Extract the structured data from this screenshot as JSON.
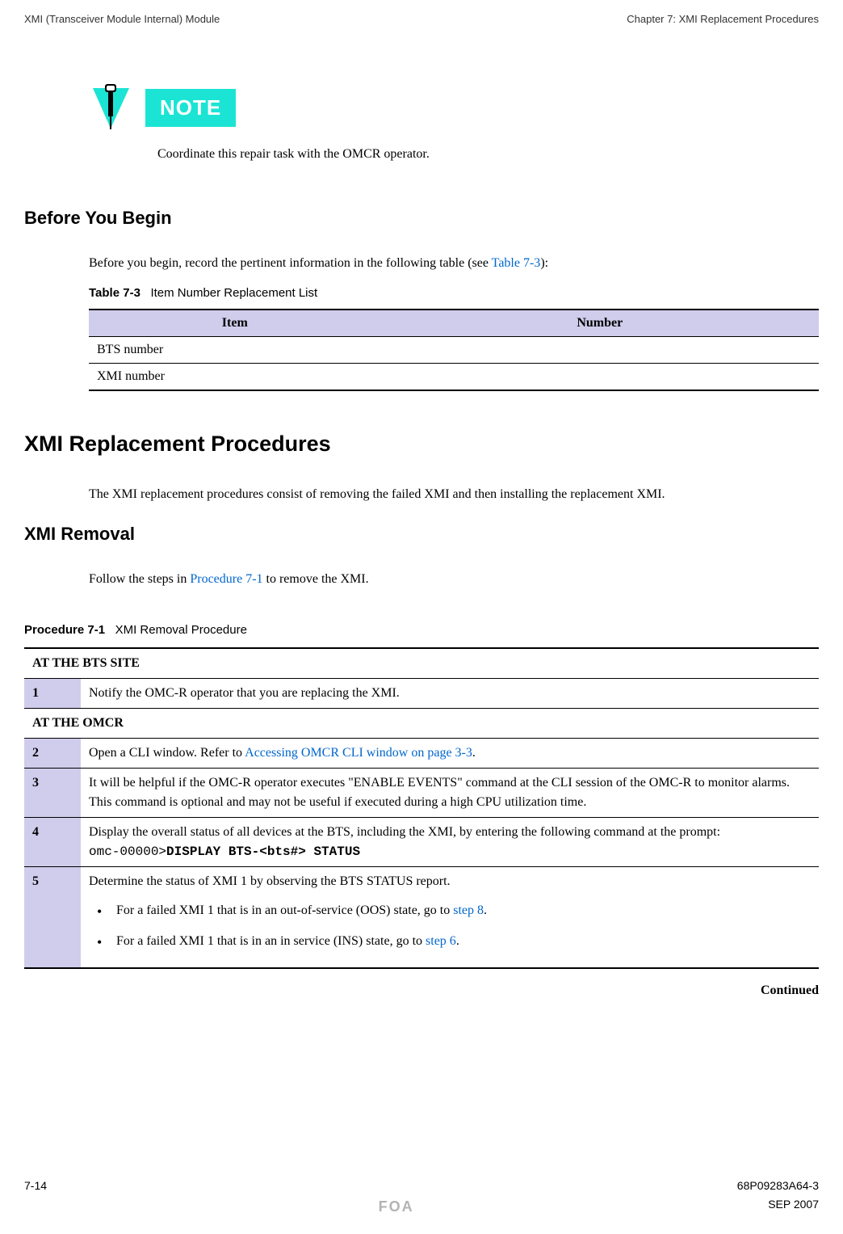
{
  "header": {
    "left": "XMI (Transceiver Module Internal) Module",
    "right": "Chapter 7: XMI Replacement Procedures"
  },
  "note": {
    "badge": "NOTE",
    "text": "Coordinate this repair task with the OMCR operator."
  },
  "sections": {
    "before_begin": {
      "title": "Before You Begin",
      "intro_pre": "Before you begin, record the pertinent information in the following table (see ",
      "intro_link": "Table 7-3",
      "intro_post": "):"
    },
    "table73": {
      "caption_bold": "Table 7-3",
      "caption_rest": "Item Number Replacement List",
      "headers": {
        "item": "Item",
        "number": "Number"
      },
      "rows": [
        {
          "item": "BTS number",
          "number": ""
        },
        {
          "item": "XMI number",
          "number": ""
        }
      ]
    },
    "xmi_proc": {
      "title": "XMI Replacement Procedures",
      "intro": "The XMI replacement procedures consist of removing the failed XMI and then installing the replacement XMI."
    },
    "xmi_removal": {
      "title": "XMI Removal",
      "intro_pre": "Follow the steps in ",
      "intro_link": "Procedure 7-1",
      "intro_post": " to remove the XMI."
    },
    "proc71": {
      "caption_bold": "Procedure 7-1",
      "caption_rest": "XMI Removal Procedure",
      "section1": "AT THE BTS SITE",
      "step1": {
        "num": "1",
        "text": "Notify the OMC-R operator that you are replacing the XMI."
      },
      "section2": "AT THE OMCR",
      "step2": {
        "num": "2",
        "text_pre": "Open a CLI window. Refer to ",
        "link": "Accessing OMCR CLI window on page 3-3",
        "text_post": "."
      },
      "step3": {
        "num": "3",
        "text": "It will be helpful if the OMC-R operator executes \"ENABLE EVENTS\" command at the CLI session of the OMC-R to monitor alarms. This command is optional and may not be useful if executed during a high CPU utilization time."
      },
      "step4": {
        "num": "4",
        "text_line1": "Display the overall status of all devices at the BTS, including the XMI, by entering the following command at the prompt:",
        "prompt": "omc-00000>",
        "cmd": "DISPLAY BTS-<bts#> STATUS"
      },
      "step5": {
        "num": "5",
        "text": "Determine the status of XMI 1 by observing the BTS STATUS report.",
        "bullet1_pre": "For a failed XMI 1 that is in an out-of-service (OOS) state, go to ",
        "bullet1_link": "step 8",
        "bullet1_post": ".",
        "bullet2_pre": "For a failed XMI 1 that is in an in service (INS) state, go to ",
        "bullet2_link": "step 6",
        "bullet2_post": "."
      }
    },
    "continued": "Continued"
  },
  "footer": {
    "page": "7-14",
    "docnum": "68P09283A64-3",
    "foa": "FOA",
    "date": "SEP 2007"
  }
}
